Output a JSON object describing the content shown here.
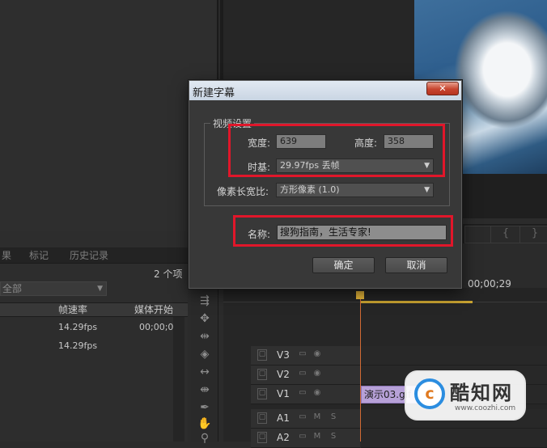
{
  "dialog": {
    "title": "新建字幕",
    "close_glyph": "✕",
    "video_settings": {
      "legend": "视频设置",
      "width_label": "宽度:",
      "width_value": "639",
      "height_label": "高度:",
      "height_value": "358",
      "timebase_label": "时基:",
      "timebase_value": "29.97fps 丢帧",
      "pixel_aspect_label": "像素长宽比:",
      "pixel_aspect_value": "方形像素 (1.0)"
    },
    "name_label": "名称:",
    "name_value": "搜狗指南，生活专家!",
    "ok_label": "确定",
    "cancel_label": "取消"
  },
  "project_panel": {
    "tabs": [
      "果",
      "标记",
      "历史记录"
    ],
    "item_count": "2 个项",
    "filter_value": "全部",
    "columns": [
      "帧速率",
      "媒体开始"
    ],
    "rows": [
      {
        "frame_rate": "14.29fps",
        "media_start": "00;00;00"
      },
      {
        "frame_rate": "14.29fps",
        "media_start": ""
      }
    ]
  },
  "timeline": {
    "timecode": "00;00;29",
    "tracks": [
      {
        "name": "V3"
      },
      {
        "name": "V2"
      },
      {
        "name": "V1"
      },
      {
        "name": "A1"
      },
      {
        "name": "A2"
      }
    ],
    "clip_label": "演示03.gif"
  },
  "watermark": {
    "logo_text": "c",
    "title": "酷知网",
    "url": "www.coozhi.com"
  },
  "colors": {
    "highlight": "#e1162a",
    "panel_bg": "#2b2b2b",
    "dialog_bg": "#383838",
    "clip": "#b7a1d8",
    "playhead": "#d06a34"
  }
}
